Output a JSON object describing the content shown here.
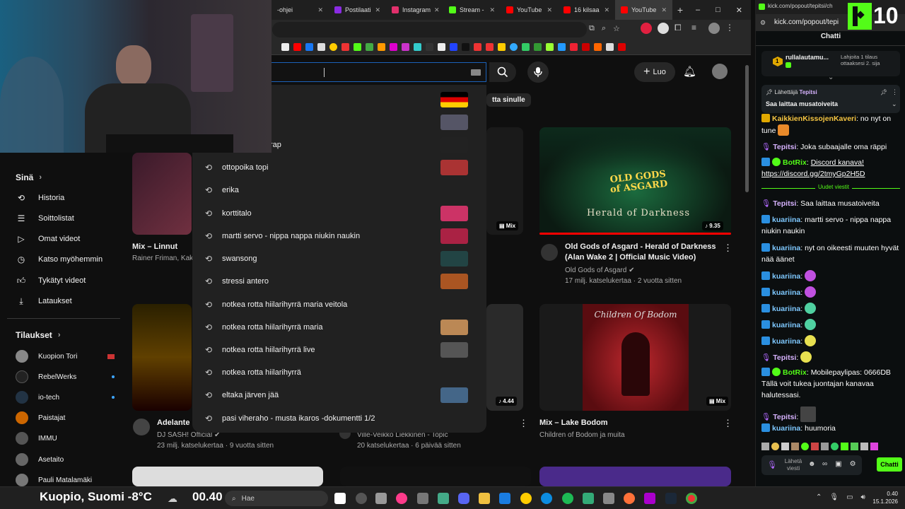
{
  "browser": {
    "tabs": [
      {
        "label": "-ohjei",
        "color": "#999"
      },
      {
        "label": "Postilaati",
        "color": "#8a2be2"
      },
      {
        "label": "Instagram",
        "color": "#e1306c"
      },
      {
        "label": "Stream -",
        "color": "#53fc18"
      },
      {
        "label": "YouTube",
        "color": "#ff0000"
      },
      {
        "label": "16 kilsaa",
        "color": "#ff0000"
      },
      {
        "label": "YouTube",
        "color": "#ff0000"
      }
    ],
    "new_tab": "+",
    "window_controls": [
      "–",
      "□",
      "✕"
    ]
  },
  "youtube": {
    "create_label": "Luo",
    "chip_partial": "tta sinulle",
    "search_value": "",
    "sidebar": {
      "you_label": "Sinä",
      "items": [
        {
          "label": "Historia",
          "icon": "history-icon"
        },
        {
          "label": "Soittolistat",
          "icon": "playlist-icon"
        },
        {
          "label": "Omat videot",
          "icon": "play-icon"
        },
        {
          "label": "Katso myöhemmin",
          "icon": "clock-icon"
        },
        {
          "label": "Tykätyt videot",
          "icon": "thumb-up-icon"
        },
        {
          "label": "Lataukset",
          "icon": "download-icon"
        }
      ],
      "subs_label": "Tilaukset",
      "subs": [
        {
          "label": "Kuopion Tori",
          "color": "#888"
        },
        {
          "label": "RebelWerks",
          "color": "#222"
        },
        {
          "label": "io-tech",
          "color": "#234"
        },
        {
          "label": "Paistajat",
          "color": "#c60"
        },
        {
          "label": "IMMU",
          "color": "#555"
        },
        {
          "label": "Asetaito",
          "color": "#666"
        },
        {
          "label": "Pauli Matalamäki",
          "color": "#777"
        }
      ]
    },
    "suggestions": [
      {
        "text": "",
        "thumb": "#c00"
      },
      {
        "text": "",
        "thumb": "#556"
      },
      {
        "text": "rap",
        "thumb": "#222"
      },
      {
        "text": "ottopoika topi",
        "thumb": "#a33"
      },
      {
        "text": "erika",
        "thumb": ""
      },
      {
        "text": "korttitalo",
        "thumb": "#c36"
      },
      {
        "text": "martti servo - nippa nappa niukin naukin",
        "thumb": "#a24"
      },
      {
        "text": "swansong",
        "thumb": "#244"
      },
      {
        "text": "stressi antero",
        "thumb": "#a52"
      },
      {
        "text": "notkea rotta hiilarihyrrä maria veitola",
        "thumb": ""
      },
      {
        "text": "notkea rotta hiilarihyrrä maria",
        "thumb": "#b85"
      },
      {
        "text": "notkea rotta hiilarihyrrä live",
        "thumb": "#555"
      },
      {
        "text": "notkea rotta hiilarihyrrä",
        "thumb": ""
      },
      {
        "text": "eltaka järven jää",
        "thumb": "#468"
      },
      {
        "text": "pasi viheraho - musta ikaros -dokumentti 1/2",
        "thumb": ""
      }
    ],
    "videos": [
      {
        "title": "Mix – Linnut",
        "meta1": "Rainer Friman, Kak",
        "meta2": "",
        "badge": ""
      },
      {
        "title": "",
        "meta1": "",
        "meta2": "",
        "badge": "Mix"
      },
      {
        "title": "Old Gods of Asgard - Herald of Darkness (Alan Wake 2 | Official Music Video)",
        "meta1": "Old Gods of Asgard",
        "meta2": "17 milj. katselukertaa · 2 vuotta sitten",
        "badge": "9.35"
      },
      {
        "title": "Adelante",
        "meta1": "DJ SASH! Official",
        "meta2": "23 milj. katselukertaa · 9 vuotta sitten",
        "badge": ""
      },
      {
        "title": "",
        "meta1": "Ville-Veikko Liekkinen - Topic",
        "meta2": "20 katselukertaa · 6 päivää sitten",
        "badge": "4.44"
      },
      {
        "title": "Mix – Lake Bodom",
        "meta1": "Children of Bodom ja muita",
        "meta2": "",
        "badge": "Mix"
      }
    ],
    "thumb_text": {
      "asgard_logo": "OLD GODS of ASGARD",
      "asgard_sub": "Herald of Darkness",
      "bodom_logo": "Children Of Bodom"
    }
  },
  "chat": {
    "url": "kick.com/popout/tepitsi/ch",
    "url2": "kick.com/popout/tepi",
    "viewers": "10",
    "title": "Chatti",
    "top_user": "rullalautamu...",
    "top_count": "1",
    "gift_text": "Lahjoita 1 tilaus ottaaksesi 2. sija",
    "pinned_by": "Lähettäjä",
    "pinned_user": "Tepitsi",
    "pinned_msg": "Saa laittaa musatoiveita",
    "new_messages": "Uudet viestit",
    "messages": [
      {
        "user": "KaikkienKissojenKaveri",
        "text": "no nyt on tune",
        "color": "#f5c542"
      },
      {
        "user": "Tepitsi",
        "text": "Joka subaajalle oma räppi",
        "color": "#d7b3ff"
      },
      {
        "user": "BotRix",
        "text": "Discord kanava! https://discord.gg/2tmyGp2H5D",
        "color": "#53fc18"
      },
      {
        "user": "Tepitsi",
        "text": "Saa laittaa musatoiveita",
        "color": "#d7b3ff"
      },
      {
        "user": "kuariina",
        "text": "martti servo - nippa nappa niukin naukin",
        "color": "#7ec8ff"
      },
      {
        "user": "kuariina",
        "text": "nyt on oikeesti muuten hyvät nää äänet",
        "color": "#7ec8ff"
      },
      {
        "user": "kuariina",
        "text": "",
        "color": "#7ec8ff"
      },
      {
        "user": "kuariina",
        "text": "",
        "color": "#7ec8ff"
      },
      {
        "user": "kuariina",
        "text": "",
        "color": "#7ec8ff"
      },
      {
        "user": "kuariina",
        "text": "",
        "color": "#7ec8ff"
      },
      {
        "user": "kuariina",
        "text": "",
        "color": "#7ec8ff"
      },
      {
        "user": "Tepitsi",
        "text": "",
        "color": "#d7b3ff"
      },
      {
        "user": "BotRix",
        "text": "Mobilepaylipas: 0666DB Tällä voit tukea juontajan kanavaa halutessasi.",
        "color": "#53fc18"
      },
      {
        "user": "Tepitsi",
        "text": "",
        "color": "#d7b3ff"
      },
      {
        "user": "kuariina",
        "text": "huumoria",
        "color": "#7ec8ff"
      }
    ],
    "send_placeholder": "Lähetä viesti",
    "chat_button": "Chatti"
  },
  "weather_overlay": {
    "location": "Kuopio, Suomi",
    "temp": "-8°C",
    "time": "00.40"
  },
  "taskbar": {
    "search": "Hae",
    "time": "0.40",
    "date": "15.1.2026"
  },
  "colors": {
    "kick_green": "#53fc18",
    "yt_red": "#ff0000",
    "link_blue": "#3ea6ff"
  }
}
